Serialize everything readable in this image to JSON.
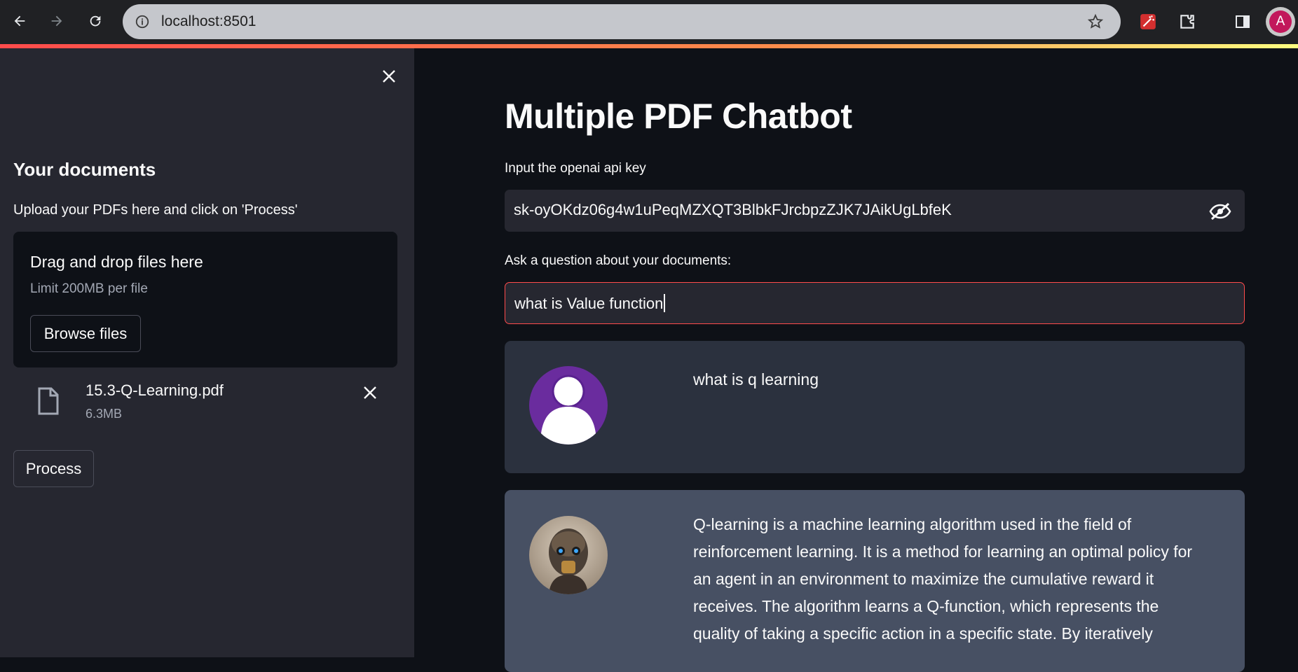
{
  "browser": {
    "url": "localhost:8501",
    "profile_initial": "A"
  },
  "sidebar": {
    "title": "Your documents",
    "description": "Upload your PDFs here and click on 'Process'",
    "dropzone": {
      "title": "Drag and drop files here",
      "limit": "Limit 200MB per file",
      "browse_label": "Browse files"
    },
    "file": {
      "name": "15.3-Q-Learning.pdf",
      "size": "6.3MB"
    },
    "process_label": "Process"
  },
  "main": {
    "title": "Multiple PDF Chatbot",
    "api_key_label": "Input the openai api key",
    "api_key_value": "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",
    "question_label": "Ask a question about your documents:",
    "question_value": "what is Value function",
    "messages": [
      {
        "role": "user",
        "text": "what is q learning"
      },
      {
        "role": "bot",
        "lines": [
          "Q-learning is a machine learning algorithm used in the field of",
          "reinforcement learning. It is a method for learning an optimal policy for",
          "an agent in an environment to maximize the cumulative reward it",
          "receives. The algorithm learns a Q-function, which represents the",
          "quality of taking a specific action in a specific state. By iteratively"
        ]
      }
    ]
  },
  "colors": {
    "accent": "#ff4b4b",
    "user_bubble": "#2b313e",
    "bot_bubble": "#475063",
    "user_avatar": "#6a2c9e"
  },
  "icons": [
    "back-arrow-icon",
    "forward-arrow-icon",
    "reload-icon",
    "info-icon",
    "star-icon",
    "extension-wand-icon",
    "puzzle-icon",
    "sidepanel-icon",
    "close-icon",
    "file-icon",
    "eye-slash-icon",
    "user-avatar-icon",
    "robot-avatar-icon"
  ]
}
